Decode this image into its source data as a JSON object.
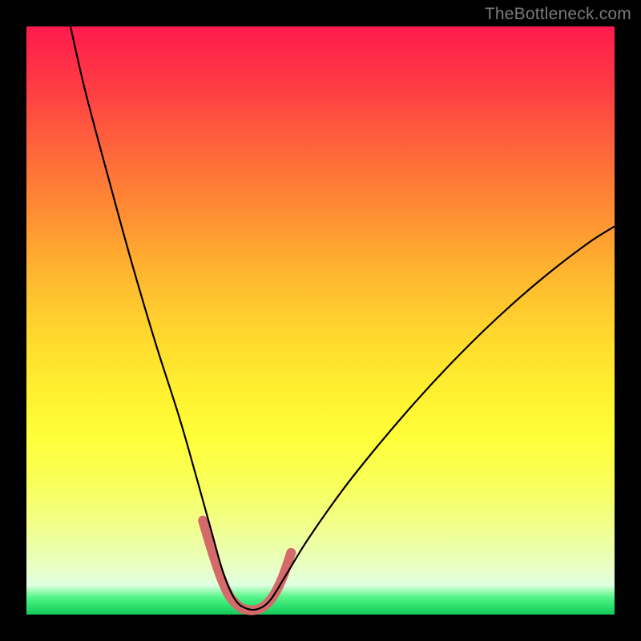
{
  "watermark": "TheBottleneck.com",
  "frame": {
    "outer_size_px": 800,
    "border_px": 33,
    "border_color": "#000000"
  },
  "gradient": {
    "type": "vertical-linear",
    "stops": [
      {
        "pos": 0.0,
        "color": "#ff1a4d"
      },
      {
        "pos": 0.1,
        "color": "#ff3b44"
      },
      {
        "pos": 0.22,
        "color": "#ff6a3a"
      },
      {
        "pos": 0.32,
        "color": "#ff8f33"
      },
      {
        "pos": 0.42,
        "color": "#ffb62f"
      },
      {
        "pos": 0.52,
        "color": "#ffd72e"
      },
      {
        "pos": 0.62,
        "color": "#fff02f"
      },
      {
        "pos": 0.7,
        "color": "#ffff3a"
      },
      {
        "pos": 0.78,
        "color": "#f8ff5a"
      },
      {
        "pos": 0.86,
        "color": "#f0ff94"
      },
      {
        "pos": 0.92,
        "color": "#e8ffc4"
      },
      {
        "pos": 0.95,
        "color": "#dfffe1"
      },
      {
        "pos": 0.97,
        "color": "#59f58a"
      },
      {
        "pos": 0.985,
        "color": "#2de26e"
      },
      {
        "pos": 1.0,
        "color": "#15c95c"
      }
    ]
  },
  "chart_data": {
    "type": "line",
    "title": "",
    "xlabel": "",
    "ylabel": "",
    "xlim": [
      0,
      1
    ],
    "ylim": [
      0,
      1
    ],
    "note": "Coordinates are normalized over the 734×734 inner plot area. y=0 is the top (most bottleneck / red), y=1 is the bottom (optimal / green). The V-shaped curve reaches the bottom around x≈0.33–0.42.",
    "series": [
      {
        "name": "bottleneck-curve",
        "stroke": "#000000",
        "stroke_width": 2.2,
        "x": [
          0.075,
          0.1,
          0.14,
          0.18,
          0.22,
          0.26,
          0.29,
          0.315,
          0.335,
          0.355,
          0.375,
          0.395,
          0.415,
          0.44,
          0.48,
          0.54,
          0.6,
          0.66,
          0.72,
          0.78,
          0.84,
          0.9,
          0.96,
          1.0
        ],
        "y": [
          0.0,
          0.11,
          0.26,
          0.405,
          0.54,
          0.665,
          0.77,
          0.86,
          0.93,
          0.975,
          0.99,
          0.99,
          0.975,
          0.935,
          0.87,
          0.785,
          0.71,
          0.64,
          0.575,
          0.515,
          0.46,
          0.41,
          0.365,
          0.34
        ]
      },
      {
        "name": "valley-highlight",
        "stroke": "#d46a6a",
        "stroke_width": 12,
        "linecap": "round",
        "x": [
          0.3,
          0.315,
          0.33,
          0.345,
          0.36,
          0.375,
          0.39,
          0.405,
          0.42,
          0.435,
          0.45
        ],
        "y": [
          0.84,
          0.89,
          0.935,
          0.968,
          0.985,
          0.992,
          0.992,
          0.985,
          0.968,
          0.938,
          0.895
        ]
      }
    ]
  }
}
